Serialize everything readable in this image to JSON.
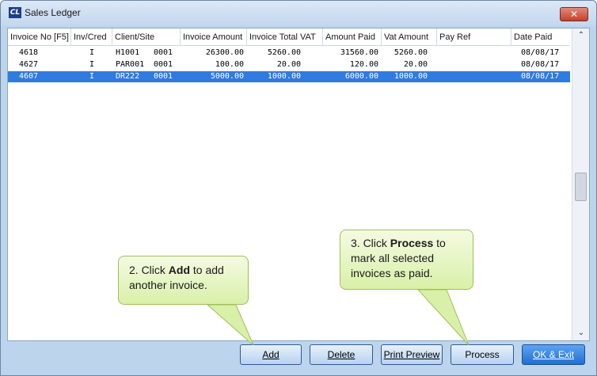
{
  "window": {
    "title": "Sales Ledger",
    "app_icon": "CL",
    "close_glyph": "✕"
  },
  "columns": [
    "Invoice No [F5]",
    "Inv/Cred",
    "Client/Site",
    "Invoice Amount",
    "Invoice Total VAT",
    "Amount Paid",
    "Vat Amount",
    "Pay Ref",
    "Date Paid"
  ],
  "rows": [
    {
      "invoice": "4618",
      "type": "I",
      "client": "H1001",
      "site": "0001",
      "amount": "26300.00",
      "total_vat": "5260.00",
      "paid": "31560.00",
      "vat": "5260.00",
      "pay_ref": "",
      "date": "08/08/17",
      "selected": false
    },
    {
      "invoice": "4627",
      "type": "I",
      "client": "PAR001",
      "site": "0001",
      "amount": "100.00",
      "total_vat": "20.00",
      "paid": "120.00",
      "vat": "20.00",
      "pay_ref": "",
      "date": "08/08/17",
      "selected": false
    },
    {
      "invoice": "4607",
      "type": "I",
      "client": "DR222",
      "site": "0001",
      "amount": "5000.00",
      "total_vat": "1000.00",
      "paid": "6000.00",
      "vat": "1000.00",
      "pay_ref": "",
      "date": "08/08/17",
      "selected": true
    }
  ],
  "buttons": {
    "add": "Add",
    "delete": "Delete",
    "print_preview": "Print Preview",
    "process": "Process",
    "ok_exit": "OK & Exit"
  },
  "scroll": {
    "up": "⌃",
    "down": "⌄"
  },
  "callouts": {
    "add": {
      "prefix": "2. Click ",
      "bold": "Add",
      "suffix": " to add another invoice."
    },
    "process": {
      "prefix": "3. Click ",
      "bold": "Process",
      "suffix": " to mark all selected invoices as paid."
    }
  },
  "colors": {
    "selection": "#2f7be0",
    "callout": "#d9f0a8",
    "primary_button": "#1f6fd0"
  }
}
